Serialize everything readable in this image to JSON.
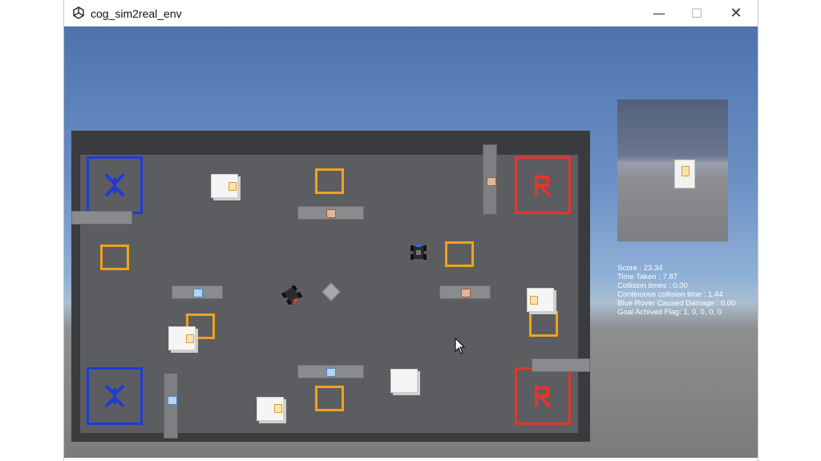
{
  "window": {
    "title": "cog_sim2real_env",
    "controls": {
      "minimize": "—",
      "maximize": "☐",
      "close": "✕"
    }
  },
  "colors": {
    "blue_team": "#1f3bd6",
    "red_team": "#e0362d",
    "goal": "#f2a21b",
    "hud_text": "#ffffff"
  },
  "hud": {
    "stats": [
      "Score : 23.34",
      "Time Taken : 7.87",
      "Collision times : 0.00",
      "Continuous collision time : 1.44",
      "Blue Rover Caused Damage : 0.00",
      "Goal Achived Flag: 1, 0, 0, 0, 0"
    ],
    "blue_lines": [
      "",
      ""
    ],
    "red_lines": [
      "",
      ""
    ]
  },
  "icons": {
    "app": "unity-logo-icon",
    "blue_base": "blue-base-emblem-icon",
    "red_base": "red-base-emblem-icon",
    "cursor": "mouse-pointer-icon"
  }
}
